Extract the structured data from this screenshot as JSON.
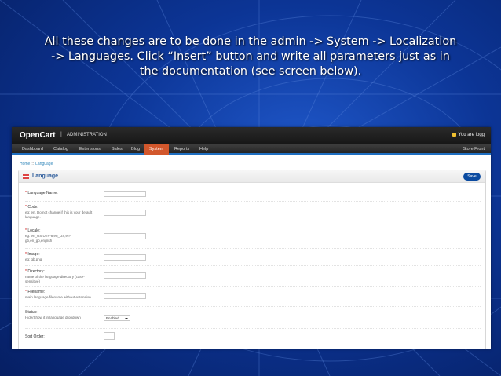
{
  "caption": {
    "line1": "All these changes are to be done in the admin -> System -> Localization",
    "line2": "-> Languages. Click “Insert” button and write all parameters just as in",
    "line3": "the documentation (see screen below)."
  },
  "header": {
    "logo": "OpenCart",
    "logo_sep": "|",
    "admin_label": "ADMINISTRATION",
    "user_label": "You are logg"
  },
  "menu": {
    "items": [
      "Dashboard",
      "Catalog",
      "Extensions",
      "Sales",
      "Blog",
      "System",
      "Reports",
      "Help"
    ],
    "active": "System",
    "store_label": "Store Front"
  },
  "breadcrumb": {
    "home": "Home",
    "sep": "::",
    "current": "Language"
  },
  "panel": {
    "title": "Language",
    "save_label": "Save"
  },
  "form": {
    "language_name": {
      "label": "Language Name:"
    },
    "code": {
      "label": "Code:",
      "help": "eg: en. Do not change if this is your default language."
    },
    "locale": {
      "label": "Locale:",
      "help": "eg: en_US.UTF-8,en_US,en-gb,en_gb,english"
    },
    "image": {
      "label": "Image:",
      "help": "eg: gb.png"
    },
    "directory": {
      "label": "Directory:",
      "help": "name of the language directory (case-sensitive)"
    },
    "filename": {
      "label": "Filename:",
      "help": "main language filename without extension"
    },
    "status": {
      "label": "Status:",
      "help": "Hide/Show it in language dropdown",
      "value": "Enabled"
    },
    "sort_order": {
      "label": "Sort Order:"
    }
  },
  "colors": {
    "menu_active": "#d2572c",
    "accent": "#1e6ec0",
    "save_button": "#0a4aa0"
  }
}
